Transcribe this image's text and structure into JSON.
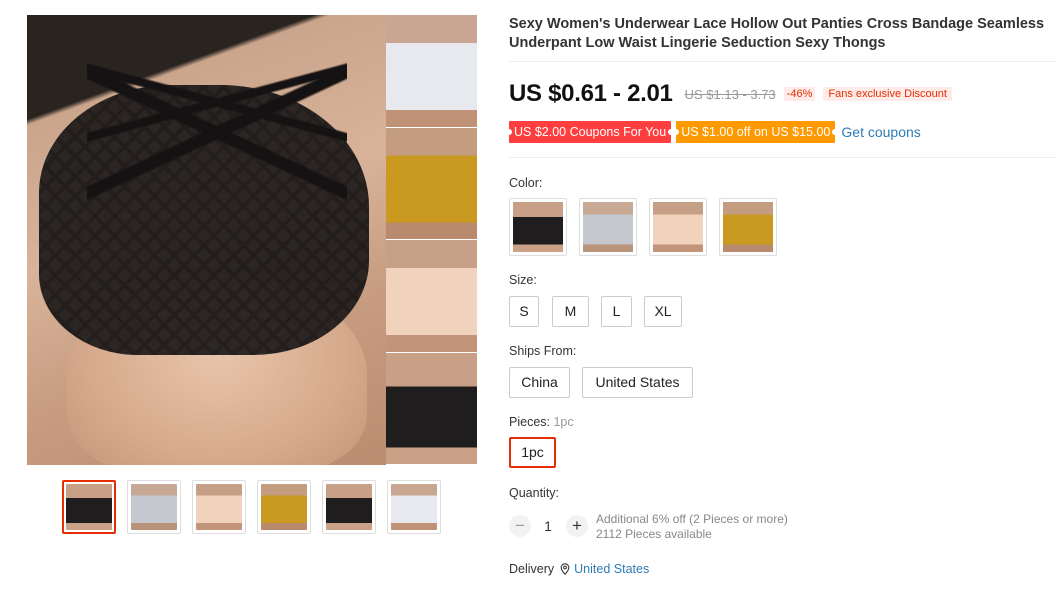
{
  "product": {
    "title": "Sexy Women's Underwear Lace Hollow Out Panties Cross Bandage Seamless Underpant Low Waist Lingerie Seduction Sexy Thongs"
  },
  "price": {
    "current": "US $0.61 - 2.01",
    "original": "US $1.13 - 3.73",
    "discount": "-46%",
    "fans_badge": "Fans exclusive Discount"
  },
  "coupons": {
    "coupon1": "US $2.00 Coupons For You",
    "coupon2": "US $1.00 off on US $15.00",
    "get_link": "Get coupons"
  },
  "color": {
    "label": "Color:",
    "options": [
      "black",
      "grey",
      "beige",
      "yellow"
    ]
  },
  "size": {
    "label": "Size:",
    "options": [
      "S",
      "M",
      "L",
      "XL"
    ]
  },
  "ships_from": {
    "label": "Ships From:",
    "options": [
      "China",
      "United States"
    ]
  },
  "pieces": {
    "label": "Pieces:",
    "selected_hint": "1pc",
    "options": [
      "1pc"
    ]
  },
  "quantity": {
    "label": "Quantity:",
    "value": "1",
    "minus": "−",
    "plus": "+",
    "note_line1": "Additional 6% off (2 Pieces or more)",
    "note_line2": "2112 Pieces available"
  },
  "delivery": {
    "label": "Delivery",
    "location": "United States"
  },
  "gallery": {
    "thumbnails": [
      "black",
      "grey",
      "beige",
      "yellow",
      "black",
      "white"
    ],
    "active_index": 0
  },
  "colors": {
    "accent_red": "#e62e04",
    "link_blue": "#2e7bb5",
    "coupon_red": "#ff3f3f",
    "coupon_orange": "#ff9900"
  }
}
